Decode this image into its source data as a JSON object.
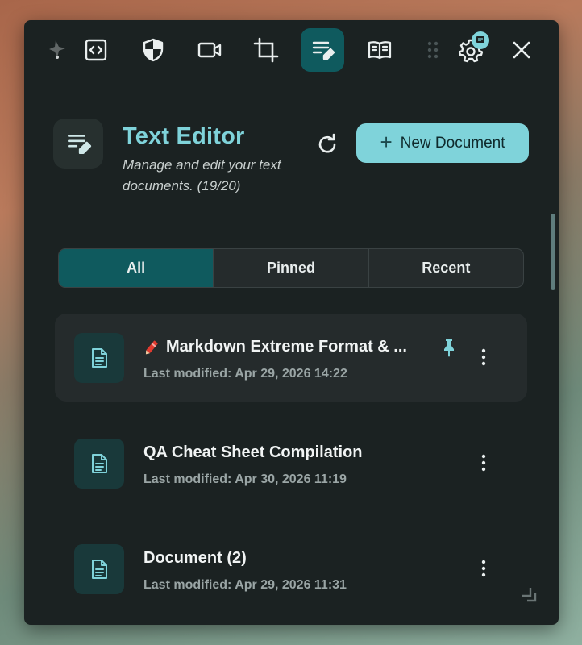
{
  "toolbar": {
    "items": [
      {
        "name": "logo-icon"
      },
      {
        "name": "code-icon"
      },
      {
        "name": "shield-icon"
      },
      {
        "name": "video-camera-icon"
      },
      {
        "name": "crop-icon"
      },
      {
        "name": "text-editor-icon",
        "active": true
      },
      {
        "name": "book-icon"
      },
      {
        "name": "drag-handle-icon"
      },
      {
        "name": "settings-icon",
        "badge": "notification-badge-icon"
      },
      {
        "name": "close-icon"
      }
    ]
  },
  "header": {
    "title": "Text Editor",
    "subtitle": "Manage and edit your text documents. (19/20)",
    "refresh_icon": "refresh-icon",
    "new_document_label": "New Document"
  },
  "tabs": [
    {
      "label": "All",
      "active": true
    },
    {
      "label": "Pinned",
      "active": false
    },
    {
      "label": "Recent",
      "active": false
    }
  ],
  "documents": [
    {
      "emoji": "crayon",
      "title": "Markdown Extreme Format & ...",
      "modified": "Last modified: Apr 29, 2026 14:22",
      "pinned": true,
      "highlighted": true
    },
    {
      "title": "QA Cheat Sheet Compilation",
      "modified": "Last modified: Apr 30, 2026 11:19",
      "pinned": false
    },
    {
      "title": "Document (2)",
      "modified": "Last modified: Apr 29, 2026 11:31",
      "pinned": false
    }
  ],
  "colors": {
    "accent": "#7fd3da",
    "active_bg": "#0f5a5e",
    "panel_bg": "#1b2222",
    "card_bg": "#252b2c"
  }
}
